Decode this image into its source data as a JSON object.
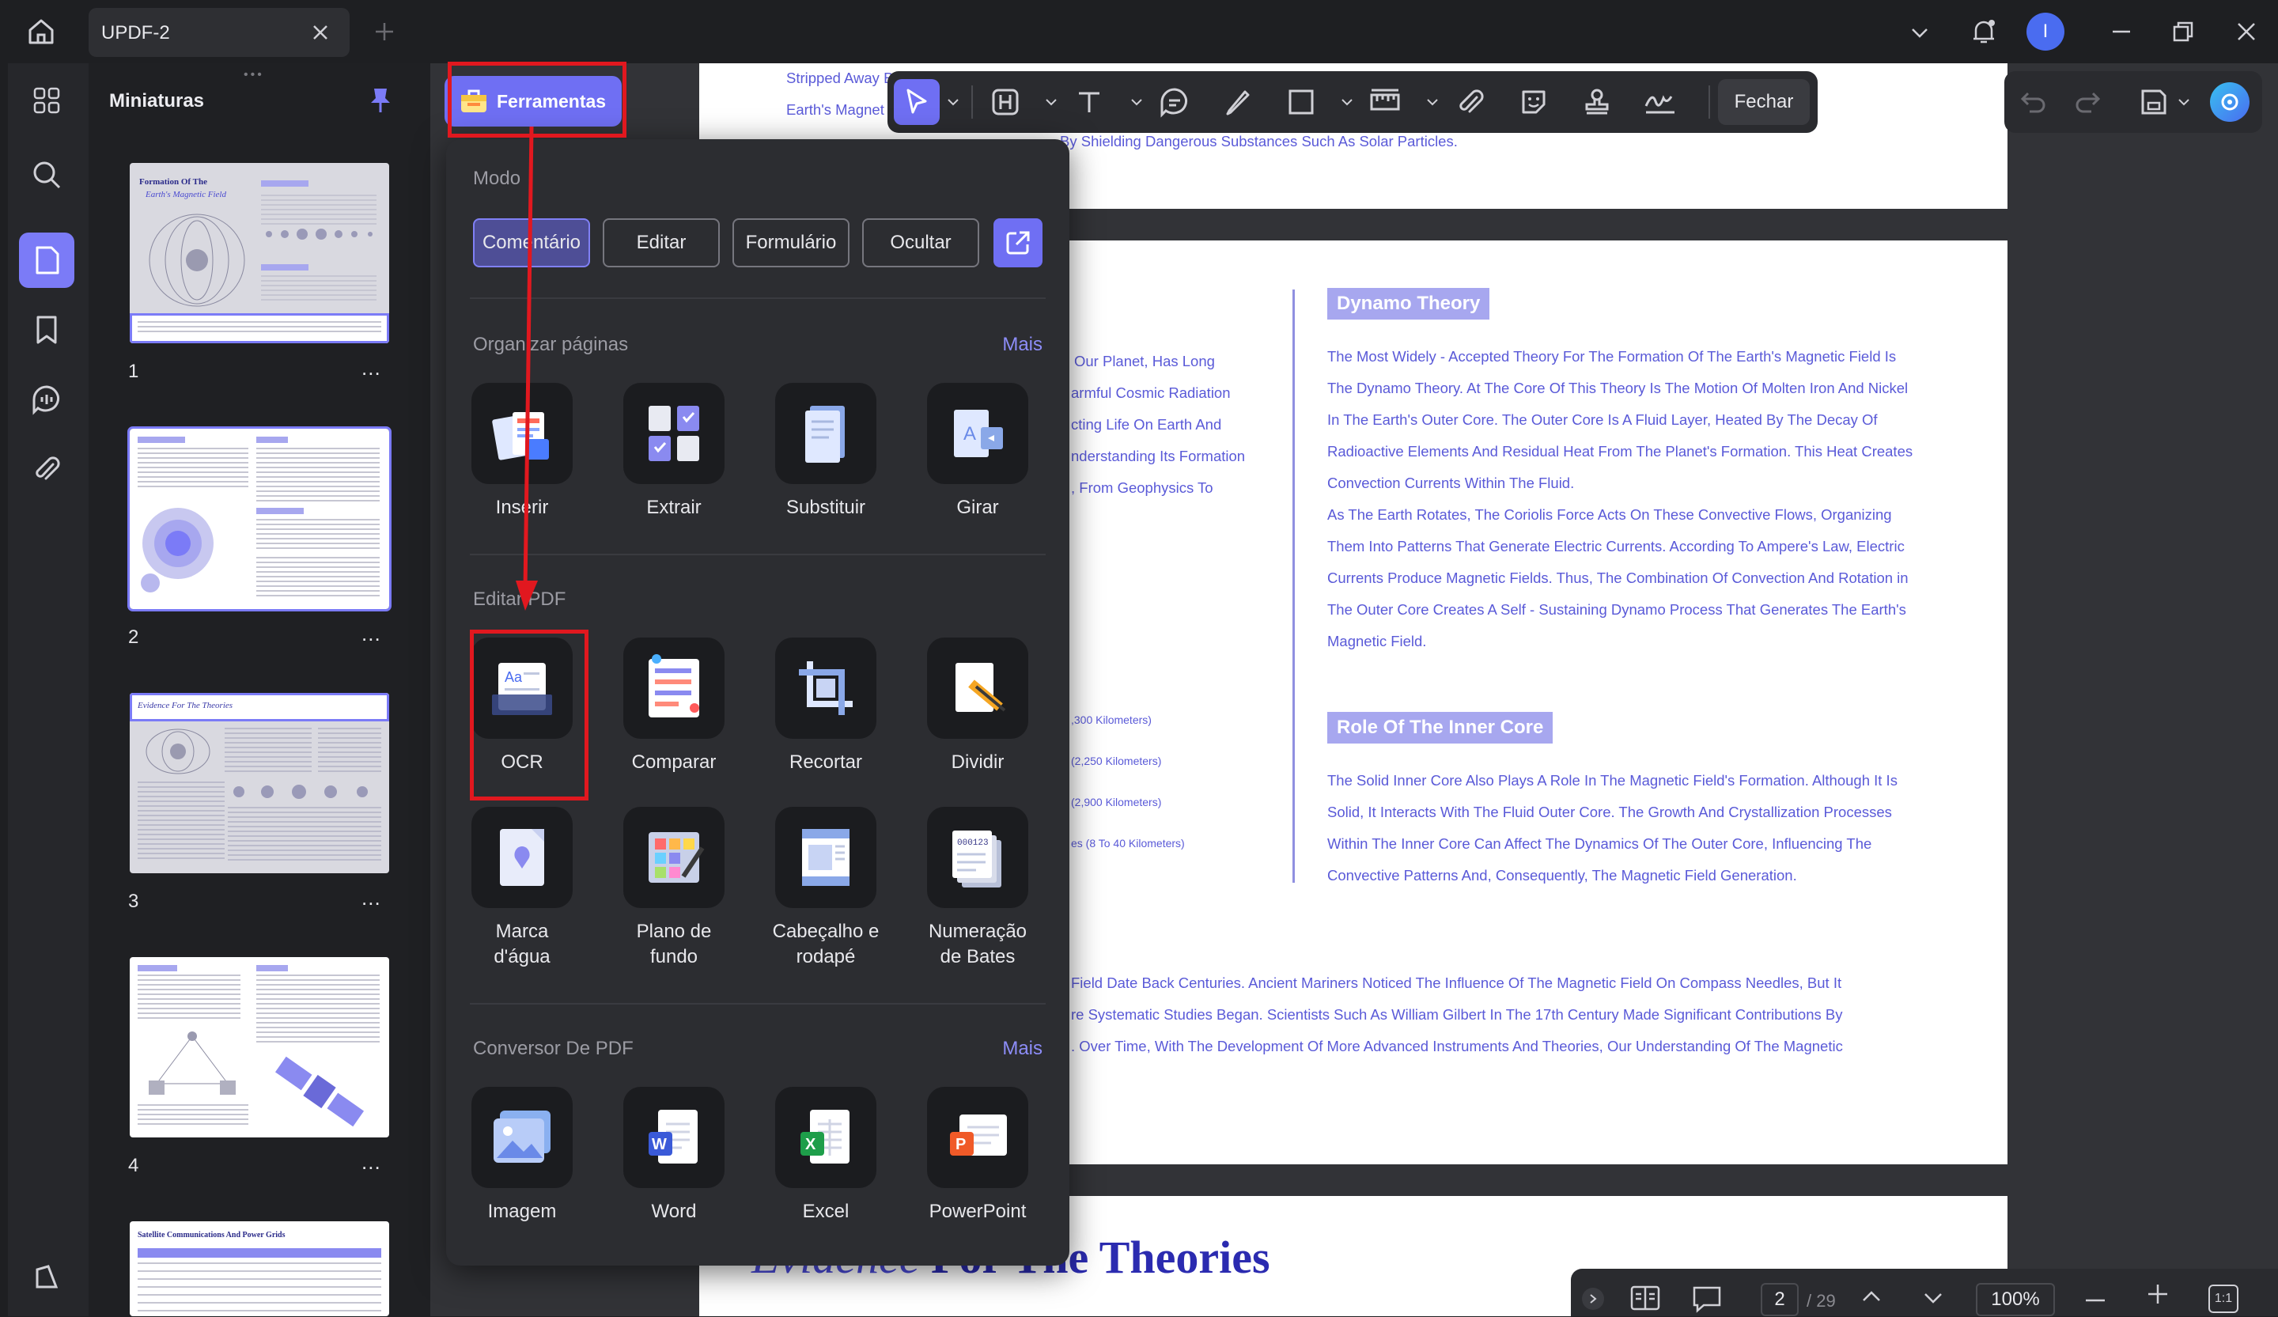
{
  "app": {
    "tab_title": "UPDF-2",
    "avatar_letter": "I",
    "accent": "#7b7bf7",
    "highlight_red": "#e1181f"
  },
  "titlebar_icons": [
    "home-icon",
    "close-icon",
    "add-tab-icon",
    "chevron-down-icon",
    "bell-icon",
    "minimize-icon",
    "restore-icon",
    "close-window-icon"
  ],
  "sidebar": {
    "title": "Miniaturas",
    "pages": [
      "1",
      "2",
      "3",
      "4"
    ],
    "more": "..."
  },
  "tools_button": {
    "label": "Ferramentas"
  },
  "annotation_bar": {
    "close_label": "Fechar"
  },
  "tools_panel": {
    "mode_title": "Modo",
    "modes": [
      "Comentário",
      "Editar",
      "Formulário",
      "Ocultar"
    ],
    "organize": {
      "title": "Organizar páginas",
      "more": "Mais",
      "items": [
        "Inserir",
        "Extrair",
        "Substituir",
        "Girar"
      ]
    },
    "edit": {
      "title": "Editar PDF",
      "row1": [
        "OCR",
        "Comparar",
        "Recortar",
        "Dividir"
      ],
      "row2": [
        "Marca\nd'água",
        "Plano de\nfundo",
        "Cabeçalho e\nrodapé",
        "Numeração\nde Bates"
      ]
    },
    "convert": {
      "title": "Conversor De PDF",
      "more": "Mais",
      "items": [
        "Imagem",
        "Word",
        "Excel",
        "PowerPoint"
      ]
    }
  },
  "doc": {
    "top_lines": [
      "Stripped Away B",
      "Earth's Magnet",
      "By Shielding Dangerous Substances Such As Solar Particles."
    ],
    "left_fragments": [
      "Our Planet, Has Long",
      "armful Cosmic Radiation",
      "cting Life On Earth And",
      "nderstanding Its Formation",
      ", From Geophysics To"
    ],
    "layer_fragments": [
      ",300 Kilometers)",
      "(2,250 Kilometers)",
      "(2,900 Kilometers)",
      "es (8 To 40 Kilometers)"
    ],
    "dynamo_title": "Dynamo Theory",
    "dynamo_lines": [
      "The Most Widely - Accepted Theory For The Formation Of The Earth's Magnetic Field Is",
      "The Dynamo Theory. At The Core Of This Theory Is The Motion Of Molten Iron And Nickel",
      "In The Earth's Outer Core. The Outer Core Is A Fluid Layer, Heated By The Decay Of",
      "Radioactive Elements And Residual Heat From The Planet's Formation. This Heat Creates",
      "Convection Currents Within The Fluid.",
      "As The Earth Rotates, The Coriolis Force Acts On These Convective Flows, Organizing",
      "Them Into Patterns That Generate Electric Currents. According To Ampere's Law, Electric",
      "Currents Produce Magnetic Fields. Thus, The Combination Of Convection And Rotation in",
      "The Outer Core Creates A Self - Sustaining Dynamo Process That Generates The Earth's",
      "Magnetic Field."
    ],
    "inner_title": "Role Of The Inner Core",
    "inner_lines": [
      "The Solid Inner Core Also Plays A Role In The Magnetic Field's Formation. Although It Is",
      "Solid, It Interacts With The Fluid Outer Core. The Growth And Crystallization Processes",
      "Within The Inner Core Can Affect The Dynamics Of The Outer Core, Influencing The",
      "Convective Patterns And, Consequently, The Magnetic Field Generation."
    ],
    "bottom_lines": [
      "Field Date Back Centuries. Ancient Mariners Noticed The Influence Of The Magnetic Field On Compass Needles, But It",
      "re Systematic Studies Began. Scientists Such As William Gilbert In The 17th Century Made Significant Contributions By",
      ". Over Time, With The Development Of More Advanced Instruments And Theories, Our Understanding Of The Magnetic"
    ],
    "next_heading_a": "Evidence",
    "next_heading_b": "For The Theories"
  },
  "thumbs": {
    "t1_title_a": "Formation Of The",
    "t1_title_b": "Earth's Magnetic Field",
    "t3_title": "Evidence For The Theories",
    "t5_title": "Satellite Communications And Power Grids"
  },
  "bottom_bar": {
    "page_current": "2",
    "page_total": "/ 29",
    "zoom": "100%",
    "fit": "1:1"
  }
}
